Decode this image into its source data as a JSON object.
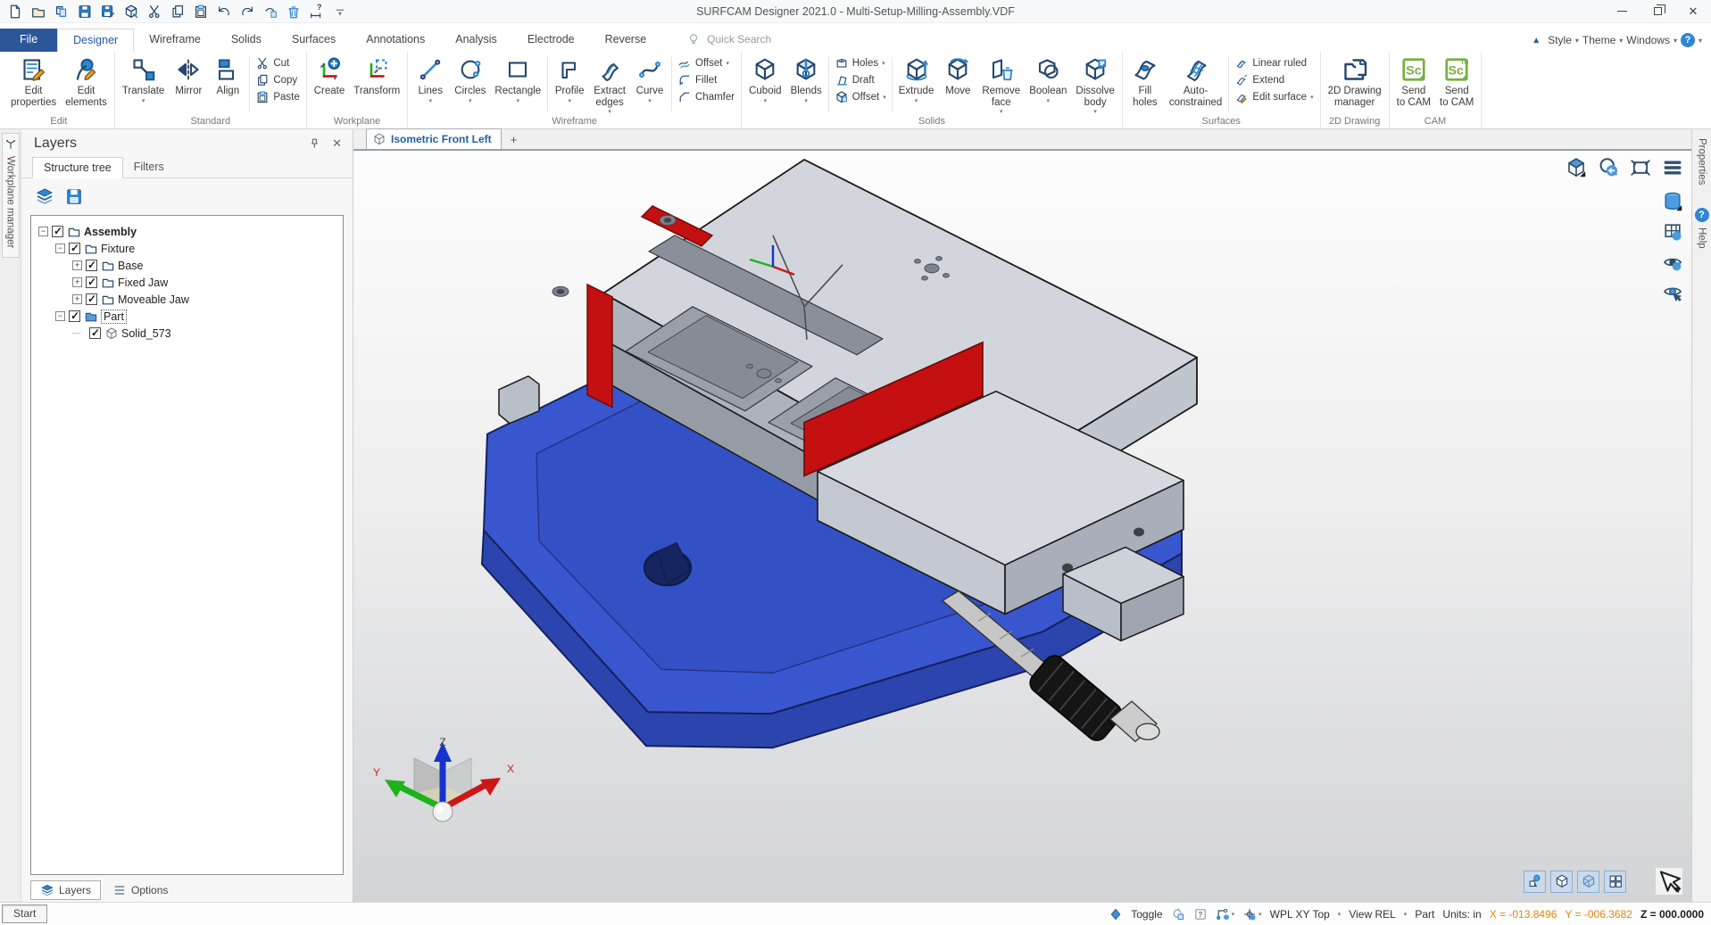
{
  "window": {
    "title": "SURFCAM Designer 2021.0 - Multi-Setup-Milling-Assembly.VDF"
  },
  "quick_access": [
    {
      "icon": "new"
    },
    {
      "icon": "open"
    },
    {
      "icon": "import"
    },
    {
      "icon": "save"
    },
    {
      "icon": "save-as"
    },
    {
      "icon": "export-3d"
    },
    {
      "icon": "cut"
    },
    {
      "icon": "copy"
    },
    {
      "icon": "paste"
    },
    {
      "icon": "undo"
    },
    {
      "icon": "redo"
    },
    {
      "icon": "undo-doc"
    },
    {
      "icon": "delete"
    },
    {
      "icon": "measure"
    },
    {
      "icon": "toolbar-more"
    }
  ],
  "menu": {
    "tabs": [
      {
        "label": "File",
        "style": "file"
      },
      {
        "label": "Designer",
        "style": "active"
      },
      {
        "label": "Wireframe"
      },
      {
        "label": "Solids"
      },
      {
        "label": "Surfaces"
      },
      {
        "label": "Annotations"
      },
      {
        "label": "Analysis"
      },
      {
        "label": "Electrode"
      },
      {
        "label": "Reverse"
      }
    ],
    "search_placeholder": "Quick Search",
    "right_items": [
      "Style",
      "Theme",
      "Windows"
    ]
  },
  "ribbon": {
    "groups": [
      {
        "label": "Edit",
        "items": [
          {
            "type": "large",
            "label": "Edit\nproperties",
            "icon": "editprops"
          },
          {
            "type": "large",
            "label": "Edit\nelements",
            "icon": "editelems"
          }
        ]
      },
      {
        "label": "Standard",
        "items": [
          {
            "type": "large",
            "label": "Translate",
            "icon": "translate",
            "caret": true
          },
          {
            "type": "large",
            "label": "Mirror",
            "icon": "mirror"
          },
          {
            "type": "large",
            "label": "Align",
            "icon": "align"
          },
          {
            "type": "sep"
          },
          {
            "type": "stack",
            "buttons": [
              {
                "label": "Cut",
                "icon": "cut"
              },
              {
                "label": "Copy",
                "icon": "copy"
              },
              {
                "label": "Paste",
                "icon": "paste"
              }
            ]
          }
        ]
      },
      {
        "label": "Workplane",
        "items": [
          {
            "type": "large",
            "label": "Create",
            "icon": "wp-create"
          },
          {
            "type": "large",
            "label": "Transform",
            "icon": "wp-transform"
          }
        ]
      },
      {
        "label": "Wireframe",
        "items": [
          {
            "type": "large",
            "label": "Lines",
            "icon": "line2",
            "caret": true
          },
          {
            "type": "large",
            "label": "Circles",
            "icon": "circle2",
            "caret": true
          },
          {
            "type": "large",
            "label": "Rectangle",
            "icon": "rect2",
            "caret": true
          },
          {
            "type": "sep"
          },
          {
            "type": "large",
            "label": "Profile",
            "icon": "profile",
            "caret": true
          },
          {
            "type": "large",
            "label": "Extract\nedges",
            "icon": "extract",
            "caret": true
          },
          {
            "type": "large",
            "label": "Curve",
            "icon": "curve",
            "caret": true
          },
          {
            "type": "sep"
          },
          {
            "type": "stack",
            "buttons": [
              {
                "label": "Offset",
                "icon": "offsetw",
                "caret": true
              },
              {
                "label": "Fillet",
                "icon": "fillet"
              },
              {
                "label": "Chamfer",
                "icon": "chamfer"
              }
            ]
          }
        ]
      },
      {
        "label": "Solids",
        "items": [
          {
            "type": "large",
            "label": "Cuboid",
            "icon": "cube",
            "caret": true
          },
          {
            "type": "large",
            "label": "Blends",
            "icon": "blends",
            "caret": true
          },
          {
            "type": "sep"
          },
          {
            "type": "stack",
            "buttons": [
              {
                "label": "Holes",
                "icon": "holes3",
                "caret": true
              },
              {
                "label": "Draft",
                "icon": "draft"
              },
              {
                "label": "Offset",
                "icon": "offset3d",
                "caret": true
              }
            ]
          },
          {
            "type": "sep"
          },
          {
            "type": "large",
            "label": "Extrude",
            "icon": "extrude",
            "caret": true
          },
          {
            "type": "large",
            "label": "Move",
            "icon": "move3d"
          },
          {
            "type": "large",
            "label": "Remove\nface",
            "icon": "removeface",
            "caret": true
          },
          {
            "type": "large",
            "label": "Boolean",
            "icon": "boolean3d",
            "caret": true
          },
          {
            "type": "large",
            "label": "Dissolve\nbody",
            "icon": "dissolve",
            "caret": true
          }
        ]
      },
      {
        "label": "Surfaces",
        "items": [
          {
            "type": "large",
            "label": "Fill\nholes",
            "icon": "fillholes"
          },
          {
            "type": "large",
            "label": "Auto-\nconstrained",
            "icon": "autoconstr"
          },
          {
            "type": "sep"
          },
          {
            "type": "stack",
            "buttons": [
              {
                "label": "Linear ruled",
                "icon": "linruled"
              },
              {
                "label": "Extend",
                "icon": "extend"
              },
              {
                "label": "Edit surface",
                "icon": "editsurf",
                "caret": true
              }
            ]
          }
        ]
      },
      {
        "label": "2D Drawing",
        "items": [
          {
            "type": "large",
            "label": "2D Drawing\nmanager",
            "icon": "drawingmgr"
          }
        ]
      },
      {
        "label": "CAM",
        "items": [
          {
            "type": "large",
            "label": "Send\nto CAM",
            "icon": "sc"
          },
          {
            "type": "large",
            "label": "Send\nto CAM",
            "icon": "sc-tm"
          }
        ]
      }
    ]
  },
  "workplane_strip": {
    "label": "Workplane manager"
  },
  "layers_panel": {
    "title": "Layers",
    "tabs": [
      {
        "label": "Structure tree",
        "active": true
      },
      {
        "label": "Filters",
        "active": false
      }
    ],
    "toolbar_icons": [
      "layers",
      "save"
    ],
    "tree": [
      {
        "label": "Assembly",
        "level": 0,
        "expander": "minus",
        "checked": true,
        "icon": "folder",
        "bold": true
      },
      {
        "label": "Fixture",
        "level": 1,
        "expander": "minus",
        "checked": true,
        "icon": "folder"
      },
      {
        "label": "Base",
        "level": 2,
        "expander": "plus",
        "checked": true,
        "icon": "folder"
      },
      {
        "label": "Fixed Jaw",
        "level": 2,
        "expander": "plus",
        "checked": true,
        "icon": "folder"
      },
      {
        "label": "Moveable Jaw",
        "level": 2,
        "expander": "plus",
        "checked": true,
        "icon": "folder"
      },
      {
        "label": "Part",
        "level": 1,
        "expander": "minus",
        "checked": true,
        "icon": "folder-sel",
        "selected": true
      },
      {
        "label": "Solid_573",
        "level": 2,
        "expander": "none",
        "checked": true,
        "icon": "solid"
      }
    ],
    "footer_tabs": [
      {
        "label": "Layers",
        "icon": "layers",
        "active": true
      },
      {
        "label": "Options",
        "icon": "options",
        "active": false
      }
    ]
  },
  "viewport": {
    "tab_label": "Isometric Front Left",
    "new_tab_label": "+",
    "axis_labels": {
      "x": "X",
      "y": "Y",
      "z": "Z"
    },
    "top_icons": [
      "view-cube",
      "orbit-zoom",
      "zoom-fit",
      "view-menu"
    ],
    "side_icons": [
      "shading-cylinder",
      "workplane-grid",
      "visibility-eye",
      "select-visible-eye"
    ],
    "bottom_icons": [
      "filter-shapes",
      "filter-solid",
      "filter-transparent",
      "filter-windows"
    ],
    "cursor_icon": "select-arrow",
    "model": {
      "description": "Machine vise fixture assembly with blue base, grey jaws, red setup plates and top fixture plate",
      "colors": {
        "base_blue": "#3857cf",
        "steel_grey": "#d2d6dc",
        "accent_red": "#c41010"
      }
    }
  },
  "right_strip": {
    "tabs": [
      "Properties",
      "Help"
    ]
  },
  "status_bar": {
    "start_label": "Start",
    "toggle_label": "Toggle",
    "icons": [
      "toggle-diamond",
      "refresh-doc",
      "help-box",
      "snap-settings",
      "auto-cursor"
    ],
    "wpl_label": "WPL XY Top",
    "view_label": "View REL",
    "part_label": "Part",
    "units_label": "Units: in",
    "coord_x": "X = -013.8496",
    "coord_y": "Y = -006.3682",
    "coord_z": "Z = 000.0000"
  },
  "colors": {
    "accent_blue": "#2b579a",
    "ribbon_icon_navy": "#24476f",
    "ribbon_icon_blue": "#2e86d1",
    "cam_green": "#76b041",
    "coord_orange": "#e8830a"
  }
}
